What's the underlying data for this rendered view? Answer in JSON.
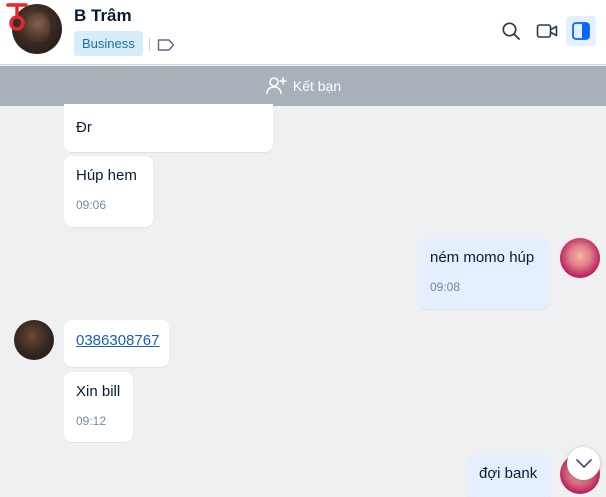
{
  "header": {
    "contact_name": "B Trâm",
    "badge": "Business",
    "icons": [
      "search-icon",
      "video-call-icon",
      "side-panel-icon",
      "tag-icon"
    ]
  },
  "friend_bar": {
    "label": "Kết bạn"
  },
  "messages": [
    {
      "side": "left",
      "text": "Đr"
    },
    {
      "side": "left",
      "text": "Húp hem",
      "time": "09:06"
    },
    {
      "side": "right",
      "text": "ném momo húp",
      "time": "09:08"
    },
    {
      "side": "left",
      "text": "0386308767"
    },
    {
      "side": "left",
      "text": "Xin bill",
      "time": "09:12"
    },
    {
      "side": "right",
      "text": "đợi bank"
    }
  ],
  "colors": {
    "accent": "#0068ff",
    "my_bubble": "#e5efff",
    "friend_bar": "#a8b0b9"
  }
}
